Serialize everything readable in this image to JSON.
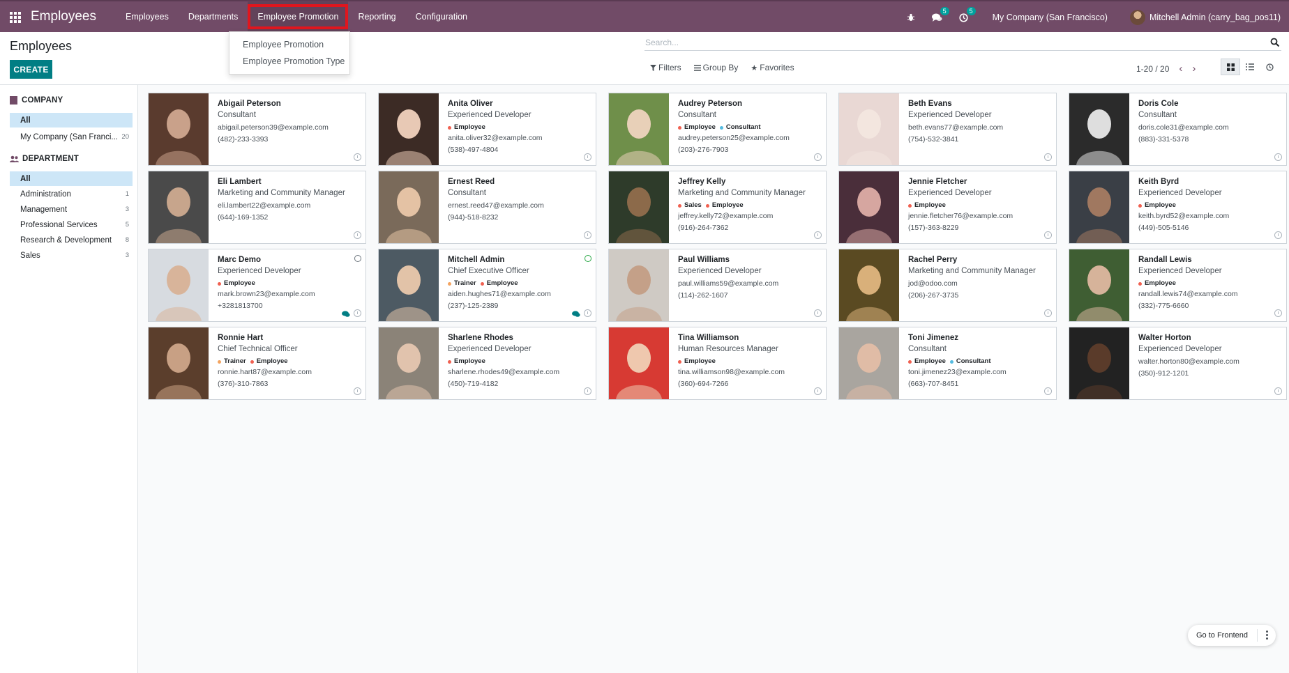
{
  "navbar": {
    "app_title": "Employees",
    "menus": [
      {
        "label": "Employees",
        "name": "menu-employees"
      },
      {
        "label": "Departments",
        "name": "menu-departments"
      },
      {
        "label": "Employee Promotion",
        "name": "menu-employee-promotion"
      },
      {
        "label": "Reporting",
        "name": "menu-reporting"
      },
      {
        "label": "Configuration",
        "name": "menu-configuration"
      }
    ],
    "messages_count": "5",
    "activities_count": "5",
    "company": "My Company (San Francisco)",
    "user": "Mitchell Admin (carry_bag_pos11)"
  },
  "dropdown": {
    "items": [
      "Employee Promotion",
      "Employee Promotion Type"
    ]
  },
  "control_panel": {
    "title": "Employees",
    "create_label": "CREATE",
    "search_placeholder": "Search...",
    "filters_label": "Filters",
    "groupby_label": "Group By",
    "favorites_label": "Favorites",
    "pager": "1-20 / 20"
  },
  "sidebar": {
    "company_header": "COMPANY",
    "company_items": [
      {
        "label": "All",
        "count": ""
      },
      {
        "label": "My Company (San Franci...",
        "count": "20"
      }
    ],
    "department_header": "DEPARTMENT",
    "department_items": [
      {
        "label": "All",
        "count": ""
      },
      {
        "label": "Administration",
        "count": "1"
      },
      {
        "label": "Management",
        "count": "3"
      },
      {
        "label": "Professional Services",
        "count": "5"
      },
      {
        "label": "Research & Development",
        "count": "8"
      },
      {
        "label": "Sales",
        "count": "3"
      }
    ]
  },
  "colors": {
    "brand": "#714B67",
    "teal": "#017e84",
    "tag_employee": "#f06050",
    "tag_consultant": "#54bbe0",
    "tag_trainer": "#f4a460",
    "tag_sales": "#f06050"
  },
  "employees": [
    {
      "name": "Abigail Peterson",
      "job": "Consultant",
      "tags": [],
      "email": "abigail.peterson39@example.com",
      "phone": "(482)-233-3393",
      "status": "",
      "chat": false
    },
    {
      "name": "Anita Oliver",
      "job": "Experienced Developer",
      "tags": [
        {
          "label": "Employee",
          "color": "#f06050"
        }
      ],
      "email": "anita.oliver32@example.com",
      "phone": "(538)-497-4804",
      "status": "",
      "chat": false
    },
    {
      "name": "Audrey Peterson",
      "job": "Consultant",
      "tags": [
        {
          "label": "Employee",
          "color": "#f06050"
        },
        {
          "label": "Consultant",
          "color": "#54bbe0"
        }
      ],
      "email": "audrey.peterson25@example.com",
      "phone": "(203)-276-7903",
      "status": "",
      "chat": false
    },
    {
      "name": "Beth Evans",
      "job": "Experienced Developer",
      "tags": [],
      "email": "beth.evans77@example.com",
      "phone": "(754)-532-3841",
      "status": "",
      "chat": false
    },
    {
      "name": "Doris Cole",
      "job": "Consultant",
      "tags": [],
      "email": "doris.cole31@example.com",
      "phone": "(883)-331-5378",
      "status": "",
      "chat": false
    },
    {
      "name": "Eli Lambert",
      "job": "Marketing and Community Manager",
      "tags": [],
      "email": "eli.lambert22@example.com",
      "phone": "(644)-169-1352",
      "status": "",
      "chat": false
    },
    {
      "name": "Ernest Reed",
      "job": "Consultant",
      "tags": [],
      "email": "ernest.reed47@example.com",
      "phone": "(944)-518-8232",
      "status": "",
      "chat": false
    },
    {
      "name": "Jeffrey Kelly",
      "job": "Marketing and Community Manager",
      "tags": [
        {
          "label": "Sales",
          "color": "#f06050"
        },
        {
          "label": "Employee",
          "color": "#f06050"
        }
      ],
      "email": "jeffrey.kelly72@example.com",
      "phone": "(916)-264-7362",
      "status": "",
      "chat": false
    },
    {
      "name": "Jennie Fletcher",
      "job": "Experienced Developer",
      "tags": [
        {
          "label": "Employee",
          "color": "#f06050"
        }
      ],
      "email": "jennie.fletcher76@example.com",
      "phone": "(157)-363-8229",
      "status": "",
      "chat": false
    },
    {
      "name": "Keith Byrd",
      "job": "Experienced Developer",
      "tags": [
        {
          "label": "Employee",
          "color": "#f06050"
        }
      ],
      "email": "keith.byrd52@example.com",
      "phone": "(449)-505-5146",
      "status": "",
      "chat": false
    },
    {
      "name": "Marc Demo",
      "job": "Experienced Developer",
      "tags": [
        {
          "label": "Employee",
          "color": "#f06050"
        }
      ],
      "email": "mark.brown23@example.com",
      "phone": "+3281813700",
      "status": "offline",
      "chat": true
    },
    {
      "name": "Mitchell Admin",
      "job": "Chief Executive Officer",
      "tags": [
        {
          "label": "Trainer",
          "color": "#f4a460"
        },
        {
          "label": "Employee",
          "color": "#f06050"
        }
      ],
      "email": "aiden.hughes71@example.com",
      "phone": "(237)-125-2389",
      "status": "online",
      "chat": true
    },
    {
      "name": "Paul Williams",
      "job": "Experienced Developer",
      "tags": [],
      "email": "paul.williams59@example.com",
      "phone": "(114)-262-1607",
      "status": "",
      "chat": false
    },
    {
      "name": "Rachel Perry",
      "job": "Marketing and Community Manager",
      "tags": [],
      "email": "jod@odoo.com",
      "phone": "(206)-267-3735",
      "status": "",
      "chat": false
    },
    {
      "name": "Randall Lewis",
      "job": "Experienced Developer",
      "tags": [
        {
          "label": "Employee",
          "color": "#f06050"
        }
      ],
      "email": "randall.lewis74@example.com",
      "phone": "(332)-775-6660",
      "status": "",
      "chat": false
    },
    {
      "name": "Ronnie Hart",
      "job": "Chief Technical Officer",
      "tags": [
        {
          "label": "Trainer",
          "color": "#f4a460"
        },
        {
          "label": "Employee",
          "color": "#f06050"
        }
      ],
      "email": "ronnie.hart87@example.com",
      "phone": "(376)-310-7863",
      "status": "",
      "chat": false
    },
    {
      "name": "Sharlene Rhodes",
      "job": "Experienced Developer",
      "tags": [
        {
          "label": "Employee",
          "color": "#f06050"
        }
      ],
      "email": "sharlene.rhodes49@example.com",
      "phone": "(450)-719-4182",
      "status": "",
      "chat": false
    },
    {
      "name": "Tina Williamson",
      "job": "Human Resources Manager",
      "tags": [
        {
          "label": "Employee",
          "color": "#f06050"
        }
      ],
      "email": "tina.williamson98@example.com",
      "phone": "(360)-694-7266",
      "status": "",
      "chat": false
    },
    {
      "name": "Toni Jimenez",
      "job": "Consultant",
      "tags": [
        {
          "label": "Employee",
          "color": "#f06050"
        },
        {
          "label": "Consultant",
          "color": "#54bbe0"
        }
      ],
      "email": "toni.jimenez23@example.com",
      "phone": "(663)-707-8451",
      "status": "",
      "chat": false
    },
    {
      "name": "Walter Horton",
      "job": "Experienced Developer",
      "tags": [],
      "email": "walter.horton80@example.com",
      "phone": "(350)-912-1201",
      "status": "",
      "chat": false
    }
  ],
  "floating": {
    "frontend_label": "Go to Frontend"
  }
}
